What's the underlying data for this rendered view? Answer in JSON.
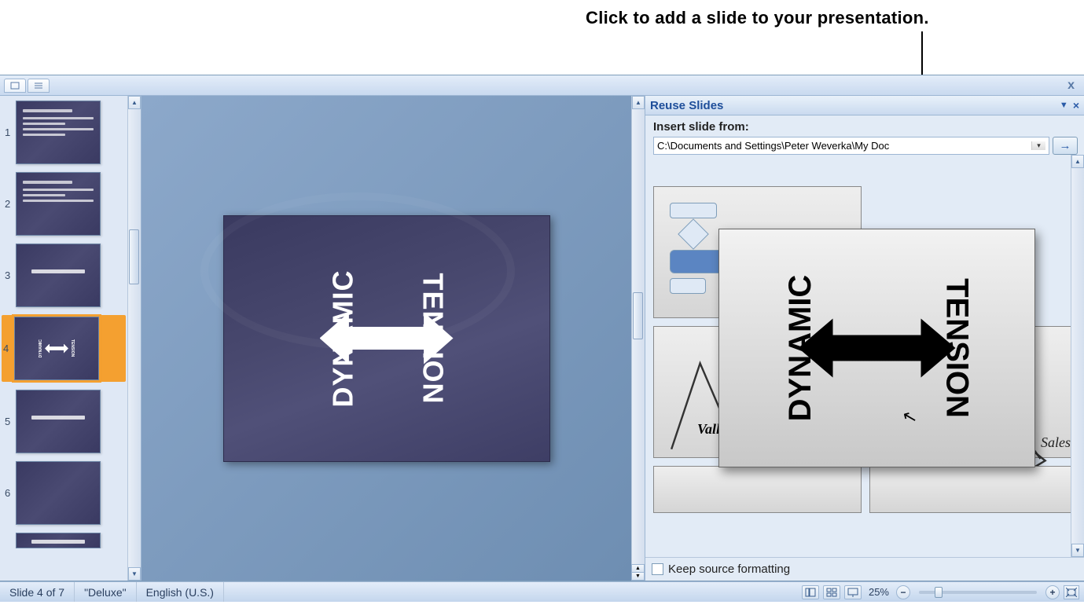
{
  "annotation": {
    "text": "Click to add a slide to your presentation."
  },
  "topbar": {
    "close_x": "x"
  },
  "thumbnails": {
    "slides": [
      {
        "num": "1",
        "layout": "bullets"
      },
      {
        "num": "2",
        "layout": "bullets"
      },
      {
        "num": "3",
        "layout": "title"
      },
      {
        "num": "4",
        "layout": "arrow",
        "selected": true
      },
      {
        "num": "5",
        "layout": "title"
      },
      {
        "num": "6",
        "layout": "blank"
      },
      {
        "num": "",
        "layout": "partial"
      }
    ]
  },
  "slide": {
    "left_word": "DYNAMIC",
    "right_word": "TENSION"
  },
  "reuse": {
    "title": "Reuse Slides",
    "insert_label": "Insert slide from:",
    "path_value": "C:\\Documents and Settings\\Peter Weverka\\My Doc",
    "go_arrow": "→",
    "keep_label": "Keep source formatting",
    "thumbs": {
      "topleft_label": "",
      "valleys": "Valleys",
      "sales": "Sales"
    }
  },
  "preview": {
    "left_word": "DYNAMIC",
    "right_word": "TENSION"
  },
  "status": {
    "slide_of": "Slide 4 of 7",
    "theme": "\"Deluxe\"",
    "language": "English (U.S.)",
    "zoom_pct": "25%",
    "minus": "−",
    "plus": "+"
  }
}
